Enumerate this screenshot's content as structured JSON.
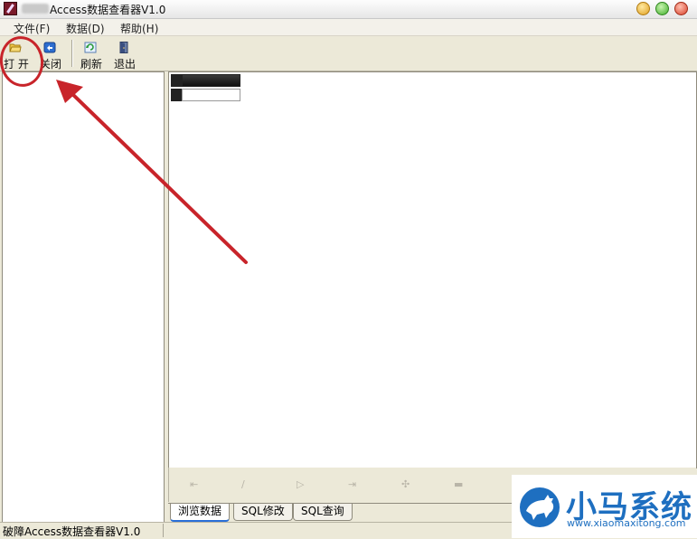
{
  "window": {
    "title": "Access数据查看器V1.0"
  },
  "menu": {
    "items": [
      {
        "label": "文件(F)"
      },
      {
        "label": "数据(D)"
      },
      {
        "label": "帮助(H)"
      }
    ]
  },
  "toolbar": {
    "open_label": "打 开",
    "close_label": "关闭",
    "refresh_label": "刷新",
    "exit_label": "退出"
  },
  "tabs": [
    {
      "label": "浏览数据",
      "active": true
    },
    {
      "label": "SQL修改",
      "active": false
    },
    {
      "label": "SQL查询",
      "active": false
    }
  ],
  "status": {
    "text": "破障Access数据查看器V1.0"
  },
  "watermark": {
    "brand": "小马系统",
    "url": "www.xiaomaxitong.com"
  },
  "colors": {
    "annotation_red": "#c8242a",
    "watermark_blue": "#1e6fc0"
  },
  "icons": [
    "folder-open-icon",
    "close-db-icon",
    "refresh-icon",
    "exit-door-icon",
    "horse-logo-icon"
  ]
}
